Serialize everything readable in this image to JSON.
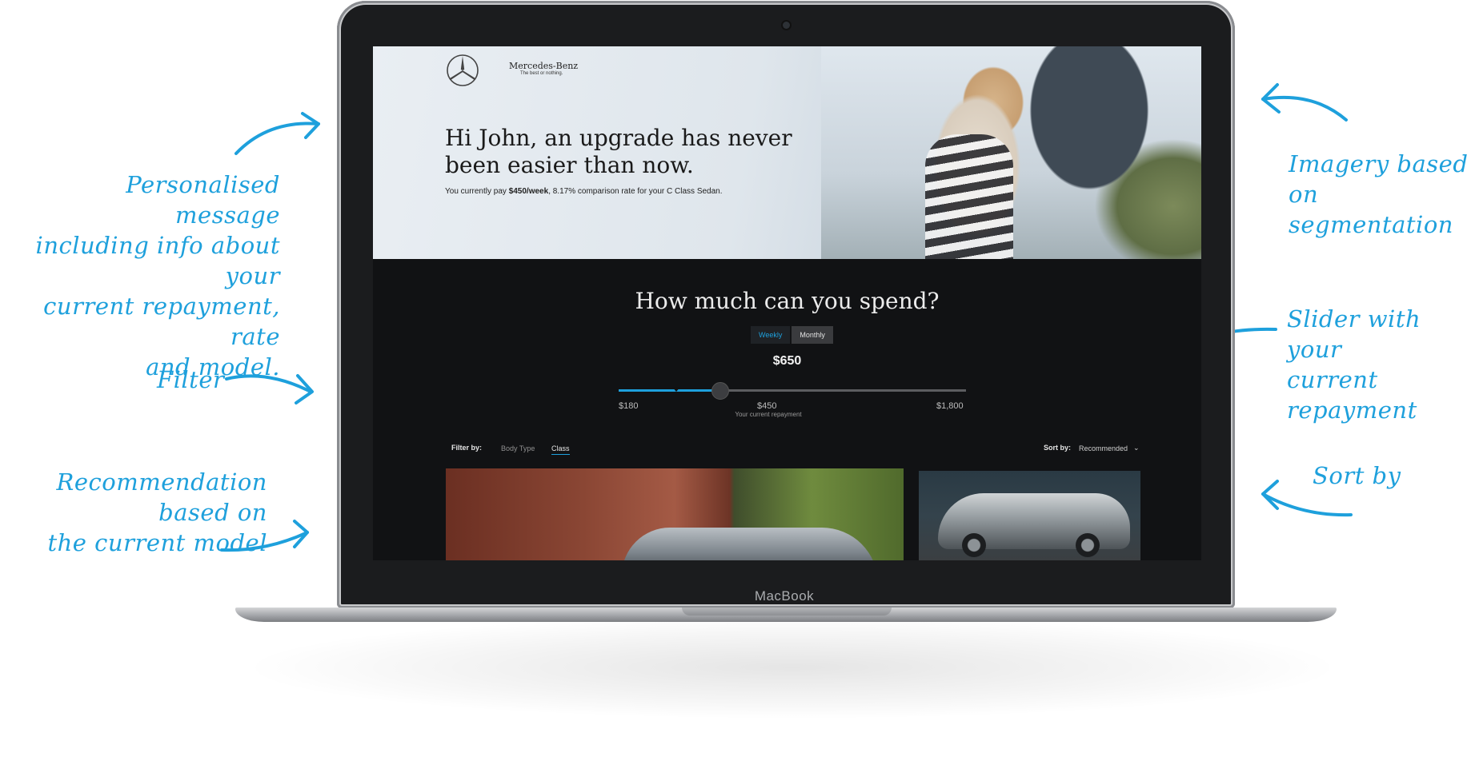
{
  "annotations": {
    "personalised": [
      "Personalised message",
      "including info about  your",
      "current repayment, rate",
      "and model."
    ],
    "filter": "Filter",
    "recommendation": [
      "Recommendation based on",
      "the current model"
    ],
    "imagery": [
      "Imagery based",
      "on segmentation"
    ],
    "slider": [
      "Slider with your",
      "current repayment"
    ],
    "sort": "Sort by"
  },
  "device": {
    "label": "MacBook"
  },
  "header": {
    "brand": "Mercedes-Benz",
    "tagline": "The best or nothing."
  },
  "hero": {
    "title": "Hi John, an upgrade has never been easier than now.",
    "sub_prefix": "You currently pay ",
    "sub_amount": "$450/week",
    "sub_suffix": ", 8.17% comparison rate for your C Class Sedan."
  },
  "spend": {
    "title": "How much can you spend?",
    "toggle": [
      "Weekly",
      "Monthly"
    ],
    "active_toggle": "Weekly"
  },
  "slider": {
    "value_label": "$650",
    "min_label": "$180",
    "current_label": "$450",
    "max_label": "$1,800",
    "current_caption": "Your current repayment",
    "min": 180,
    "max": 1800,
    "value": 650,
    "current": 450
  },
  "filter": {
    "label": "Filter by:",
    "options": [
      "Body Type",
      "Class"
    ],
    "active": "Class"
  },
  "sort": {
    "label": "Sort by:",
    "value": "Recommended"
  },
  "colors": {
    "accent": "#1ea0dc",
    "screen_bg": "#111214"
  },
  "icons": {
    "logo": "mercedes-star-icon",
    "sort": "chevron-down-icon"
  }
}
